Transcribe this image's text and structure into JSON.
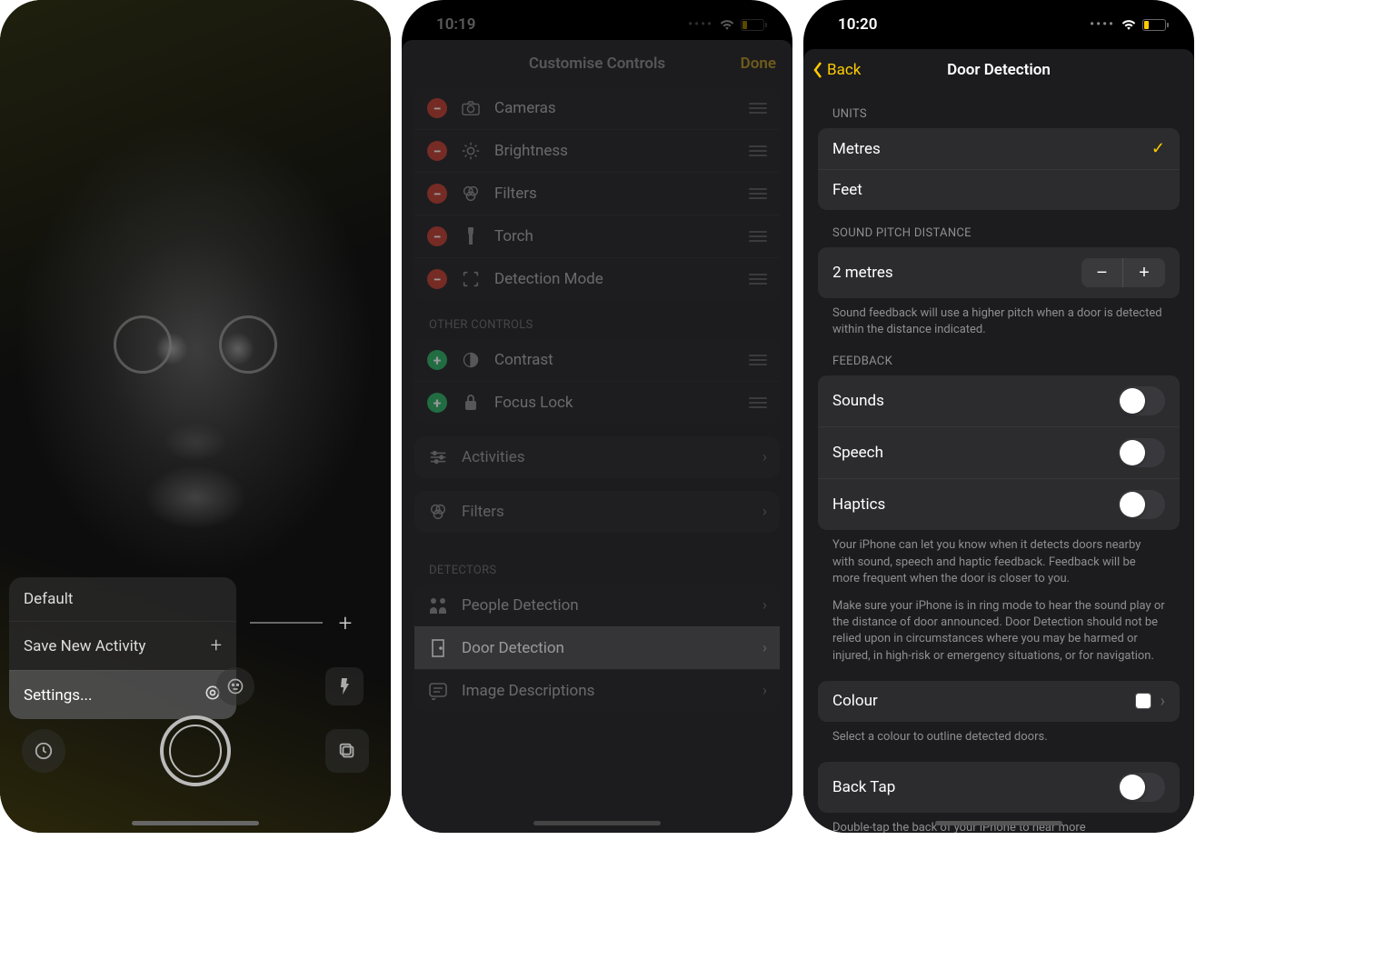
{
  "screen1": {
    "menu": {
      "default": "Default",
      "save_new": "Save New Activity",
      "settings": "Settings..."
    }
  },
  "screen2": {
    "status_time": "10:19",
    "battery": "16",
    "title": "Customise Controls",
    "done": "Done",
    "included": [
      {
        "label": "Cameras",
        "icon": "camera"
      },
      {
        "label": "Brightness",
        "icon": "brightness"
      },
      {
        "label": "Filters",
        "icon": "filters"
      },
      {
        "label": "Torch",
        "icon": "torch"
      },
      {
        "label": "Detection Mode",
        "icon": "detection"
      }
    ],
    "other_header": "OTHER CONTROLS",
    "other": [
      {
        "label": "Contrast",
        "icon": "contrast"
      },
      {
        "label": "Focus Lock",
        "icon": "lock"
      }
    ],
    "activities": "Activities",
    "filters_row": "Filters",
    "detectors_header": "DETECTORS",
    "detectors": [
      {
        "label": "People Detection",
        "icon": "people"
      },
      {
        "label": "Door Detection",
        "icon": "door"
      },
      {
        "label": "Image Descriptions",
        "icon": "image-desc"
      }
    ]
  },
  "screen3": {
    "status_time": "10:20",
    "battery": "16",
    "back": "Back",
    "title": "Door Detection",
    "units_header": "UNITS",
    "unit_metres": "Metres",
    "unit_feet": "Feet",
    "pitch_header": "SOUND PITCH DISTANCE",
    "pitch_value": "2 metres",
    "pitch_footer": "Sound feedback will use a higher pitch when a door is detected within the distance indicated.",
    "feedback_header": "FEEDBACK",
    "fb_sounds": "Sounds",
    "fb_speech": "Speech",
    "fb_haptics": "Haptics",
    "feedback_footer1": "Your iPhone can let you know when it detects doors nearby with sound, speech and haptic feedback. Feedback will be more frequent when the door is closer to you.",
    "feedback_footer2": "Make sure your iPhone is in ring mode to hear the sound play or the distance of door announced. Door Detection should not be relied upon in circumstances where you may be harmed or injured, in high-risk or emergency situations, or for navigation.",
    "colour": "Colour",
    "colour_footer": "Select a colour to outline detected doors.",
    "back_tap": "Back Tap",
    "back_tap_footer": "Double-tap the back of your iPhone to hear more"
  }
}
